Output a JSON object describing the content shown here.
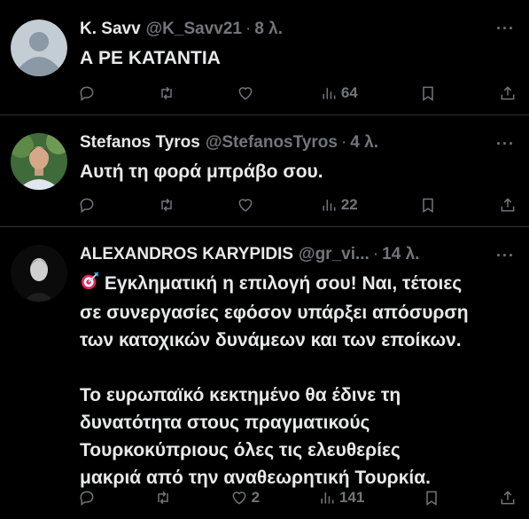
{
  "tweets": [
    {
      "name": "K. Savv",
      "handle": "@K_Savv21",
      "time": "8 λ.",
      "text": "Α ΡΕ ΚΑΤΑΝΤΙΑ",
      "likes": "",
      "views": "64",
      "more": "···"
    },
    {
      "name": "Stefanos Tyros",
      "handle": "@StefanosTyros",
      "time": "4 λ.",
      "text": "Αυτή τη φορά μπράβο σου.",
      "likes": "",
      "views": "22",
      "more": "···"
    },
    {
      "name": "ALEXANDROS KARYPIDIS",
      "handle": "@gr_vi...",
      "time": "14 λ.",
      "text": "Εγκληματική η επιλογή σου! Ναι, τέτοιες\nσε συνεργασίες εφόσον υπάρξει απόσυρση\nτων κατοχικών δυνάμεων και των εποίκων.\n\nΤο ευρωπαϊκό κεκτημένο θα έδινε τη\nδυνατότητα στους πραγματικούς\nΤουρκοκύπριους όλες τις ελευθερίες\nμακριά από την αναθεωρητική Τουρκία.",
      "likes": "2",
      "views": "141",
      "more": "···"
    }
  ],
  "colors": {
    "background": "#000000",
    "text": "#e7e9ea",
    "muted": "#71767b",
    "divider": "#2f3336",
    "emoji_target": "#e0245e"
  },
  "icons": [
    "reply-icon",
    "retweet-icon",
    "like-icon",
    "views-icon",
    "bookmark-icon",
    "share-icon",
    "target-emoji-icon"
  ]
}
